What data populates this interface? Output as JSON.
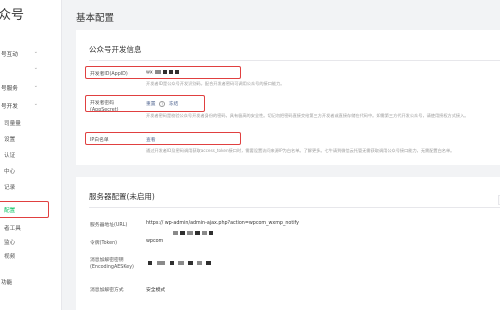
{
  "app": {
    "brand": "众号"
  },
  "sidebar": {
    "items": [
      {
        "label": "号互动",
        "chevron": "⌄"
      },
      {
        "label": "",
        "chevron": "⌄"
      },
      {
        "label": "号服务",
        "chevron": "⌄"
      },
      {
        "label": "号开发",
        "chevron": "⌄"
      },
      {
        "label": "司量量"
      },
      {
        "label": "设置"
      },
      {
        "label": "认证"
      },
      {
        "label": "中心"
      },
      {
        "label": "记录"
      },
      {
        "label": "配置"
      },
      {
        "label": "者工具"
      },
      {
        "label": "监心"
      },
      {
        "label": "视频"
      },
      {
        "label": "功能"
      }
    ],
    "active_index": 9
  },
  "page": {
    "title": "基本配置"
  },
  "dev_info": {
    "title": "公众号开发信息",
    "appid": {
      "label": "开发者ID(AppID)",
      "value": "wx",
      "desc": "开发者ID是公众号开发识别码，配合开发者密码可调用公众号的接口能力。"
    },
    "appsecret": {
      "label": "开发者密码(AppSecret)",
      "value": "重置",
      "extra": "冻结",
      "desc": "开发者密码是校验公众号开发者身份的密码，具有极高的安全性。切记勿把密码直接交给第三方开发者或直接存储在代码中。如需第三方代开发公众号，请使用授权方式接入。"
    },
    "ip_whitelist": {
      "label": "IP白名单",
      "value": "查看",
      "desc": "通过开发者ID及密码调用获取access_token接口时，需要设置访问来源IP为白名单。了解更多。七牛请到微信云托管无需获取调用公众号接口能力，无需配置白名单。"
    }
  },
  "server_config": {
    "title": "服务器配置(未启用)",
    "url": {
      "label": "服务器地址(URL)",
      "value": "https://                wp-admin/admin-ajax.php?action=wpcom_wxmp_notify"
    },
    "token": {
      "label": "令牌(Token)",
      "value": "wpcom"
    },
    "aeskey": {
      "label": "消息加解密密钥(EncodingAESKey)",
      "value": ""
    },
    "encrypt_mode": {
      "label": "消息加解密方式",
      "value": "安全模式"
    }
  },
  "colors": {
    "accent": "#07c160",
    "highlight": "#e04040",
    "link": "#576b95"
  }
}
